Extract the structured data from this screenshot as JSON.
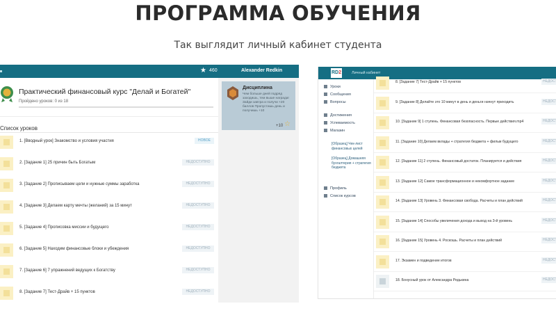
{
  "heading": "ПРОГРАММА ОБУЧЕНИЯ",
  "subheading": "Так выглядит личный кабинет студента",
  "left": {
    "topbar": {
      "star_count": "460",
      "user_name": "Alexander Redkin"
    },
    "course": {
      "title": "Практический финансовый курс \"Делай и Богатей\"",
      "progress_text": "Пройдено уроков: 0 из 18",
      "progress_value": 0
    },
    "list_title": "Список уроков",
    "lessons": [
      {
        "label": "1. [Вводный урок] Знакомство и условия участия",
        "status": "НОВОЕ"
      },
      {
        "label": "2. [Задание 1] 25 причин быть Богатым",
        "status": "НЕДОСТУПНО"
      },
      {
        "label": "3. [Задание 2] Прописываем цели и нужные суммы заработка",
        "status": "НЕДОСТУПНО"
      },
      {
        "label": "4. [Задание 3] Делаем карту мечты (желаний) за 15 минут",
        "status": "НЕДОСТУПНО"
      },
      {
        "label": "5. [Задание 4] Прописовка миссии и будущего",
        "status": "НЕДОСТУПНО"
      },
      {
        "label": "6. [Задание 5] Находим финансовые блоки и убеждения",
        "status": "НЕДОСТУПНО"
      },
      {
        "label": "7. [Задание 6] 7 упражнений ведущих к Богатству",
        "status": "НЕДОСТУПНО"
      },
      {
        "label": "8. [Задание 7] Тест-Драйв + 15 пунктов",
        "status": "НЕДОСТУПНО"
      }
    ],
    "discipline": {
      "title": "Дисциплина",
      "text": "Чем больше дней подряд заходишь, тем выше награда! Зайди завтра и получи +20 баллов Пропустишь день и получишь +10",
      "points": "+10"
    }
  },
  "right": {
    "logo": {
      "prefix": "RD",
      "suffix": "2"
    },
    "app_title": "Личный кабинет",
    "nav": {
      "items_top": [
        "Уроки",
        "Сообщения",
        "Вопросы"
      ],
      "items_mid": [
        "Достижения",
        "Успеваемость",
        "Магазин"
      ],
      "sub_items": [
        "[Образец] Чек-лист финансовых целей",
        "[Образец] Домашняя бухгалтерия + стратегия бюджета"
      ],
      "items_bottom": [
        "Профиль",
        "Список курсов"
      ]
    },
    "lessons": [
      {
        "label": "8. [Задание 7] Тест-Драйв + 15 пунктов",
        "status": "НЕДОСТУПНО"
      },
      {
        "label": "9. [Задание 8] Делайте это 10 минут в день и деньги начнут приходить",
        "status": "НЕДОСТУПНО"
      },
      {
        "label": "10. [Задание 9] 1 ступень. Финансовая безопасность. Первые действия.mp4",
        "status": "НЕДОСТУПНО"
      },
      {
        "label": "11. [Задание 10] Делаем вклады + стратегия бюджета + фильм будущего",
        "status": "НЕДОСТУПНО"
      },
      {
        "label": "12. [Задание 11] 2 ступень. Финансовый достаток. Планируется и действия",
        "status": "НЕДОСТУПНО"
      },
      {
        "label": "13. [Задание 12] Самое трансформационное и некомфортное задание",
        "status": "НЕДОСТУПНО"
      },
      {
        "label": "14. [Задание 13] Уровень 3. Финансовая свобода. Расчеты и план действий",
        "status": "НЕДОСТУПНО"
      },
      {
        "label": "15. [Задание 14] Способы увеличения дохода и выход на 3-й уровень",
        "status": "НЕДОСТУПНО"
      },
      {
        "label": "16. [Задание 15] Уровень 4. Роскошь. Расчеты и план действий",
        "status": "НЕДОСТУПНО"
      },
      {
        "label": "17. Экзамен и подведение итогов",
        "status": "НЕДОСТУПНО"
      },
      {
        "label": "18. Бонусный урок от Александра Редькина",
        "status": "НЕДОСТУПНО"
      }
    ]
  },
  "colors": {
    "topbar": "#156e83",
    "thumb": "#fbf0c4",
    "accent_star": "#e7b53a"
  }
}
